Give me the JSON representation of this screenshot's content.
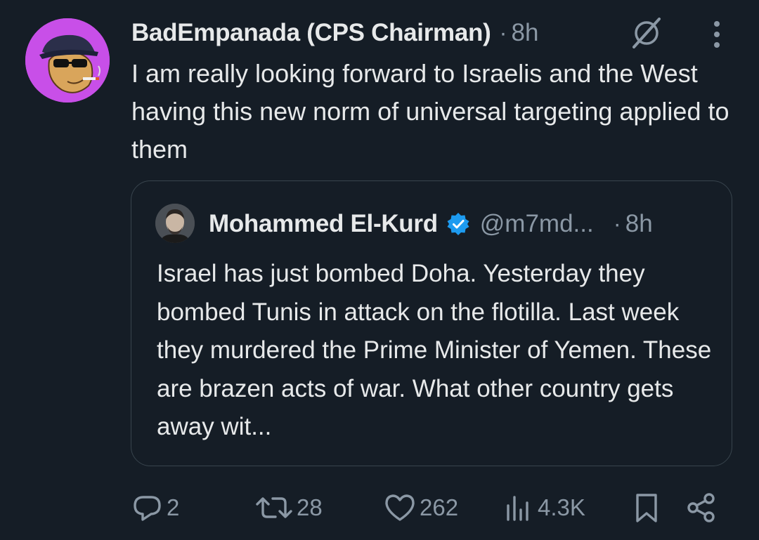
{
  "tweet": {
    "author_name": "BadEmpanada (CPS Chairman)",
    "separator": "·",
    "time": "8h",
    "text": "I am really looking forward to Israelis and the West having this new norm of universal targeting applied to them",
    "grok_icon": "grok-icon",
    "more_icon": "more-vertical-icon"
  },
  "quote": {
    "author_name": "Mohammed El-Kurd",
    "verified_icon": "verified-badge-icon",
    "handle": "@m7md...",
    "separator": "·",
    "time": "8h",
    "text": "Israel has just bombed Doha. Yesterday they bombed Tunis in attack on the flotilla. Last week they murdered the Prime Minister of Yemen. These are brazen acts of war. What other country gets away wit..."
  },
  "actions": {
    "replies": "2",
    "reposts": "28",
    "likes": "262",
    "views": "4.3K"
  },
  "colors": {
    "background": "#151d26",
    "primary_text": "#e7e9ea",
    "secondary_text": "#8b98a5",
    "border": "#38444d",
    "verified": "#1d9bf0",
    "avatar_bg": "#c84fe8"
  }
}
